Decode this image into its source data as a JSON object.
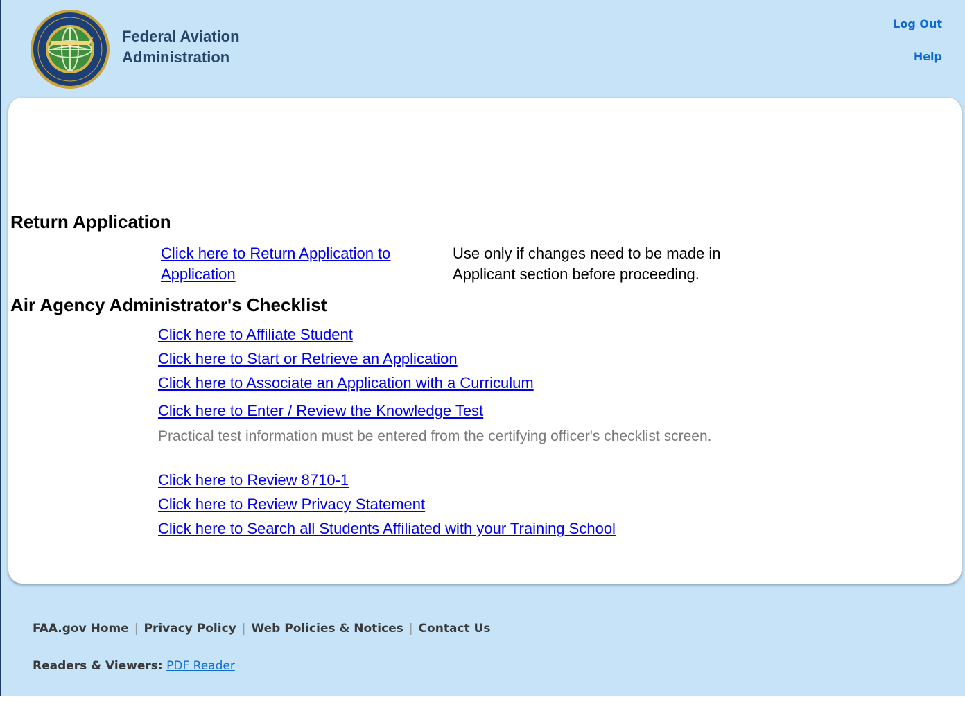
{
  "header": {
    "agency_line1": "Federal Aviation",
    "agency_line2": "Administration",
    "logout": "Log Out",
    "help": "Help",
    "logo_icon": "faa-seal-icon"
  },
  "return_section": {
    "title": "Return Application",
    "link": "Click here to Return Application to Application",
    "note": "Use only if changes need to be made in Applicant section before proceeding."
  },
  "checklist": {
    "title": "Air Agency Administrator's Checklist",
    "links": [
      "Click here to Affiliate Student",
      "Click here to Start or Retrieve an Application",
      "Click here to Associate an Application with a Curriculum",
      "Click here to Enter / Review the Knowledge Test",
      "Click here to Review 8710-1",
      "Click here to Review Privacy Statement",
      "Click here to Search all Students Affiliated with your Training School"
    ],
    "practical_note": "Practical test information must be entered from the certifying officer's checklist screen."
  },
  "footer": {
    "links": [
      "FAA.gov Home",
      "Privacy Policy",
      "Web Policies & Notices",
      "Contact Us"
    ],
    "readers_label": "Readers & Viewers:",
    "pdf_reader": "PDF Reader"
  },
  "colors": {
    "header_bg": "#c6e3f8",
    "link": "#0000ee",
    "top_link": "#0e6bd1",
    "agency_text": "#27466c"
  }
}
